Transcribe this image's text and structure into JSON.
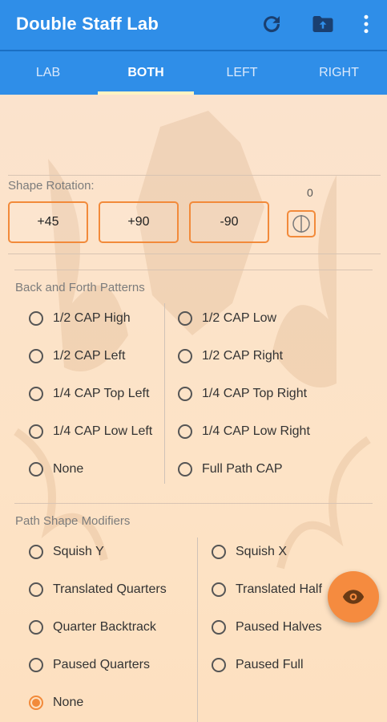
{
  "app": {
    "title": "Double Staff Lab",
    "actions": [
      "redo-icon",
      "folder-upload-icon",
      "more-vert-icon"
    ]
  },
  "tabs": [
    {
      "label": "LAB",
      "active": false
    },
    {
      "label": "BOTH",
      "active": true
    },
    {
      "label": "LEFT",
      "active": false
    },
    {
      "label": "RIGHT",
      "active": false
    }
  ],
  "rotation": {
    "label": "Shape Rotation:",
    "value": "0",
    "buttons": [
      "+45",
      "+90",
      "-90"
    ],
    "knob_icon": "rotation-dial-icon"
  },
  "back_forth": {
    "label": "Back and Forth Patterns",
    "options": [
      {
        "label": "1/2 CAP High",
        "checked": false
      },
      {
        "label": "1/2 CAP Low",
        "checked": false
      },
      {
        "label": "1/2 CAP Left",
        "checked": false
      },
      {
        "label": "1/2 CAP Right",
        "checked": false
      },
      {
        "label": "1/4 CAP Top Left",
        "checked": false
      },
      {
        "label": "1/4 CAP Top Right",
        "checked": false
      },
      {
        "label": "1/4 CAP Low Left",
        "checked": false
      },
      {
        "label": "1/4 CAP Low Right",
        "checked": false
      },
      {
        "label": "None",
        "checked": false
      },
      {
        "label": "Full Path CAP",
        "checked": false
      }
    ]
  },
  "path_mods": {
    "label": "Path Shape Modifiers",
    "options": [
      {
        "label": "Squish Y",
        "checked": false
      },
      {
        "label": "Squish X",
        "checked": false
      },
      {
        "label": "Translated Quarters",
        "checked": false
      },
      {
        "label": "Translated Half",
        "checked": false
      },
      {
        "label": "Quarter Backtrack",
        "checked": false
      },
      {
        "label": "Paused Halves",
        "checked": false
      },
      {
        "label": "Paused Quarters",
        "checked": false
      },
      {
        "label": "Paused Full",
        "checked": false
      },
      {
        "label": "None",
        "checked": true
      }
    ]
  },
  "fab": {
    "icon": "eye-icon"
  },
  "colors": {
    "primary": "#2f8ee8",
    "accent": "#f28a3a",
    "background": "#fde6cf"
  }
}
